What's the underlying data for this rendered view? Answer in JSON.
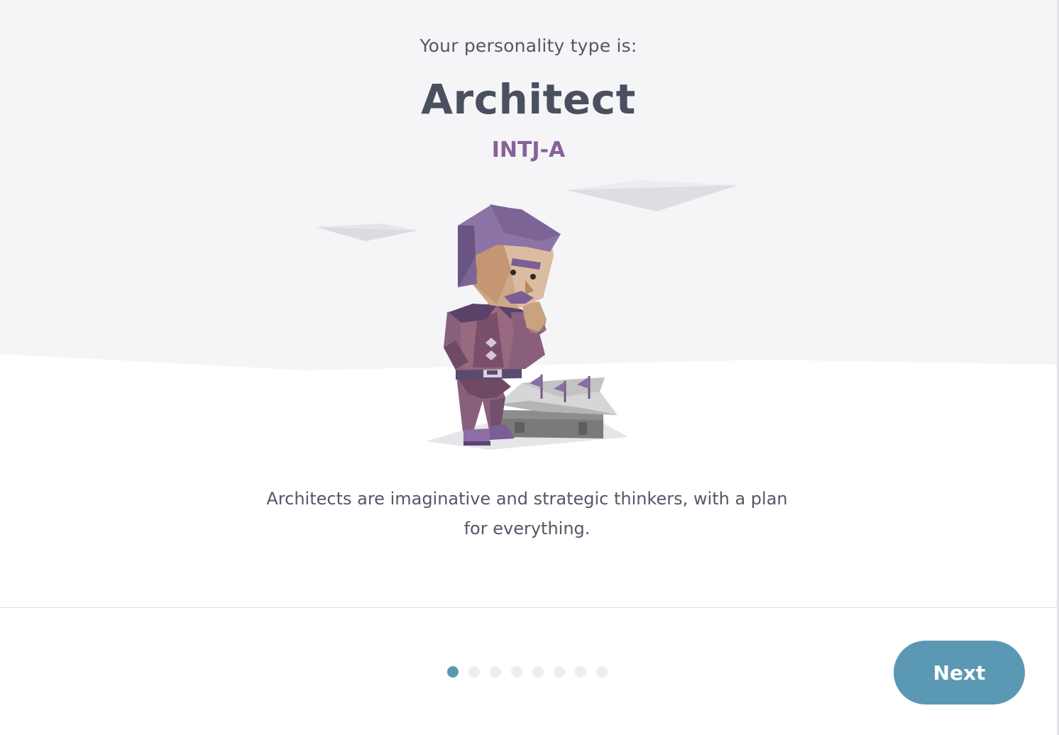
{
  "result": {
    "lead": "Your personality type is:",
    "type_name": "Architect",
    "type_code": "INTJ-A",
    "description": "Architects are imaginative and strategic thinkers, with a plan for everything."
  },
  "illustration": {
    "subject": "architect-character-illustration"
  },
  "pager": {
    "total_steps": 8,
    "current_step": 1
  },
  "footer": {
    "next_label": "Next"
  },
  "colors": {
    "accent": "#5b98b4",
    "type_code": "#88619a",
    "heading": "#4b5060",
    "background_top": "#f5f5f7",
    "inactive_dot": "#ededf0"
  }
}
